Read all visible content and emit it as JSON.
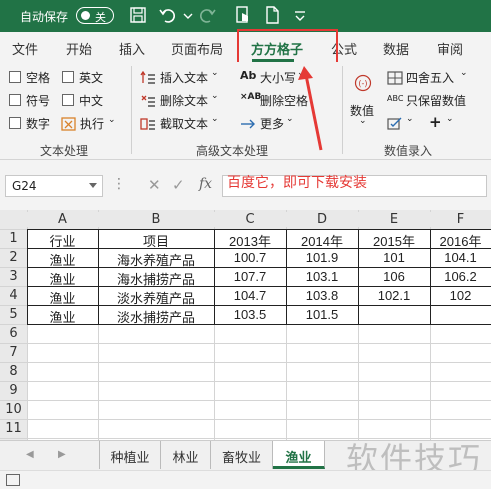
{
  "titlebar": {
    "autosave_label": "自动保存",
    "autosave_state": "关",
    "icons": [
      "save-icon",
      "undo-icon",
      "redo-icon",
      "touch-icon",
      "new-file-icon",
      "customize-icon"
    ],
    "bg_color": "#217346"
  },
  "tabs": [
    {
      "label": "文件"
    },
    {
      "label": "开始"
    },
    {
      "label": "插入"
    },
    {
      "label": "页面布局"
    },
    {
      "label": "方方格子",
      "active": true
    },
    {
      "label": "公式"
    },
    {
      "label": "数据"
    },
    {
      "label": "审阅"
    }
  ],
  "ribbon": {
    "text_group": {
      "label": "文本处理",
      "checkboxes": [
        "空格",
        "英文",
        "符号",
        "中文",
        "数字"
      ],
      "execute": "执行"
    },
    "advanced_group": {
      "label": "高级文本处理",
      "insert_text": "插入文本",
      "delete_text": "删除文本",
      "truncate_text": "截取文本",
      "case": "大小写",
      "delete_spaces": "删除空格",
      "more": "更多"
    },
    "number_group": {
      "label": "数值录入",
      "round": "四舍五入",
      "keep_values": "只保留数值",
      "value": "数值",
      "abc_label": "ABC"
    }
  },
  "formula_bar": {
    "name_box": "G24",
    "fx": "fx",
    "value": ""
  },
  "annotation": "百度它，即可下载安装",
  "sheet": {
    "columns": [
      "A",
      "B",
      "C",
      "D",
      "E",
      "F"
    ],
    "rows": [
      "1",
      "2",
      "3",
      "4",
      "5",
      "6",
      "7",
      "8",
      "9",
      "10",
      "11"
    ],
    "data": [
      [
        "行业",
        "项目",
        "2013年",
        "2014年",
        "2015年",
        "2016年"
      ],
      [
        "渔业",
        "海水养殖产品",
        "100.7",
        "101.9",
        "101",
        "104.1"
      ],
      [
        "渔业",
        "海水捕捞产品",
        "107.7",
        "103.1",
        "106",
        "106.2"
      ],
      [
        "渔业",
        "淡水养殖产品",
        "104.7",
        "103.8",
        "102.1",
        "102"
      ],
      [
        "渔业",
        "淡水捕捞产品",
        "103.5",
        "101.5",
        "",
        ""
      ]
    ]
  },
  "sheet_tabs": [
    {
      "label": "种植业"
    },
    {
      "label": "林业"
    },
    {
      "label": "畜牧业"
    },
    {
      "label": "渔业",
      "active": true
    }
  ],
  "watermark": "软件技巧",
  "colors": {
    "accent": "#217346",
    "annotation_red": "#e53935"
  }
}
